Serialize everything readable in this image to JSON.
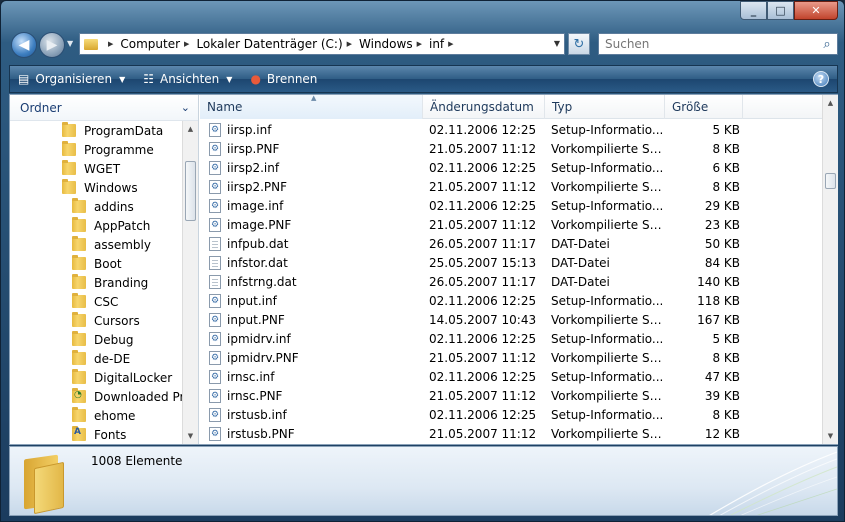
{
  "window": {
    "buttons": {
      "minimize": "_",
      "maximize": "□",
      "close": "✕"
    }
  },
  "address": {
    "crumbs": [
      "Computer",
      "Lokaler Datenträger (C:)",
      "Windows",
      "inf"
    ],
    "search_placeholder": "Suchen"
  },
  "toolbar": {
    "organize": "Organisieren",
    "views": "Ansichten",
    "burn": "Brennen"
  },
  "nav": {
    "header": "Ordner",
    "items": [
      {
        "label": "ProgramData",
        "indent": 1,
        "icon": "folder"
      },
      {
        "label": "Programme",
        "indent": 1,
        "icon": "folder"
      },
      {
        "label": "WGET",
        "indent": 1,
        "icon": "folder"
      },
      {
        "label": "Windows",
        "indent": 1,
        "icon": "folder"
      },
      {
        "label": "addins",
        "indent": 2,
        "icon": "folder"
      },
      {
        "label": "AppPatch",
        "indent": 2,
        "icon": "folder"
      },
      {
        "label": "assembly",
        "indent": 2,
        "icon": "folder"
      },
      {
        "label": "Boot",
        "indent": 2,
        "icon": "folder"
      },
      {
        "label": "Branding",
        "indent": 2,
        "icon": "folder"
      },
      {
        "label": "CSC",
        "indent": 2,
        "icon": "folder"
      },
      {
        "label": "Cursors",
        "indent": 2,
        "icon": "folder"
      },
      {
        "label": "Debug",
        "indent": 2,
        "icon": "folder"
      },
      {
        "label": "de-DE",
        "indent": 2,
        "icon": "folder"
      },
      {
        "label": "DigitalLocker",
        "indent": 2,
        "icon": "folder"
      },
      {
        "label": "Downloaded Program Files",
        "indent": 2,
        "icon": "download"
      },
      {
        "label": "ehome",
        "indent": 2,
        "icon": "folder"
      },
      {
        "label": "Fonts",
        "indent": 2,
        "icon": "special"
      }
    ]
  },
  "files": {
    "columns": [
      "Name",
      "Änderungsdatum",
      "Typ",
      "Größe"
    ],
    "sorted_column": "Name",
    "rows": [
      {
        "name": "iirsp.inf",
        "date": "02.11.2006 12:25",
        "type": "Setup-Informatio...",
        "size": "5 KB",
        "icon": "setup"
      },
      {
        "name": "iirsp.PNF",
        "date": "21.05.2007 11:12",
        "type": "Vorkompilierte Set...",
        "size": "8 KB",
        "icon": "setup"
      },
      {
        "name": "iirsp2.inf",
        "date": "02.11.2006 12:25",
        "type": "Setup-Informatio...",
        "size": "6 KB",
        "icon": "setup"
      },
      {
        "name": "iirsp2.PNF",
        "date": "21.05.2007 11:12",
        "type": "Vorkompilierte Set...",
        "size": "8 KB",
        "icon": "setup"
      },
      {
        "name": "image.inf",
        "date": "02.11.2006 12:25",
        "type": "Setup-Informatio...",
        "size": "29 KB",
        "icon": "setup"
      },
      {
        "name": "image.PNF",
        "date": "21.05.2007 11:12",
        "type": "Vorkompilierte Set...",
        "size": "23 KB",
        "icon": "setup"
      },
      {
        "name": "infpub.dat",
        "date": "26.05.2007 11:17",
        "type": "DAT-Datei",
        "size": "50 KB",
        "icon": "data"
      },
      {
        "name": "infstor.dat",
        "date": "25.05.2007 15:13",
        "type": "DAT-Datei",
        "size": "84 KB",
        "icon": "data"
      },
      {
        "name": "infstrng.dat",
        "date": "26.05.2007 11:17",
        "type": "DAT-Datei",
        "size": "140 KB",
        "icon": "data"
      },
      {
        "name": "input.inf",
        "date": "02.11.2006 12:25",
        "type": "Setup-Informatio...",
        "size": "118 KB",
        "icon": "setup"
      },
      {
        "name": "input.PNF",
        "date": "14.05.2007 10:43",
        "type": "Vorkompilierte Set...",
        "size": "167 KB",
        "icon": "setup"
      },
      {
        "name": "ipmidrv.inf",
        "date": "02.11.2006 12:25",
        "type": "Setup-Informatio...",
        "size": "5 KB",
        "icon": "setup"
      },
      {
        "name": "ipmidrv.PNF",
        "date": "21.05.2007 11:12",
        "type": "Vorkompilierte Set...",
        "size": "8 KB",
        "icon": "setup"
      },
      {
        "name": "irnsc.inf",
        "date": "02.11.2006 12:25",
        "type": "Setup-Informatio...",
        "size": "47 KB",
        "icon": "setup"
      },
      {
        "name": "irnsc.PNF",
        "date": "21.05.2007 11:12",
        "type": "Vorkompilierte Set...",
        "size": "39 KB",
        "icon": "setup"
      },
      {
        "name": "irstusb.inf",
        "date": "02.11.2006 12:25",
        "type": "Setup-Informatio...",
        "size": "8 KB",
        "icon": "setup"
      },
      {
        "name": "irstusb.PNF",
        "date": "21.05.2007 11:12",
        "type": "Vorkompilierte Set...",
        "size": "12 KB",
        "icon": "setup"
      }
    ]
  },
  "details": {
    "count": "1008 Elemente"
  },
  "colors": {
    "accent": "#1a3d73",
    "toolbar": "#2f5d85"
  }
}
